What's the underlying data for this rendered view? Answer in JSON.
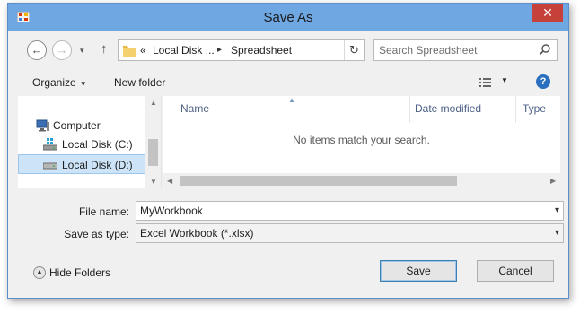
{
  "window": {
    "title": "Save As",
    "close_glyph": "✕"
  },
  "nav": {
    "back_glyph": "←",
    "forward_glyph": "→",
    "recent_glyph": "▾",
    "up_glyph": "↑"
  },
  "address": {
    "prefix": "«",
    "crumbs": [
      "Local Disk ...",
      "Spreadsheet"
    ],
    "separator": "▸",
    "refresh_glyph": "↻"
  },
  "search": {
    "placeholder": "Search Spreadsheet"
  },
  "toolbar": {
    "organize_label": "Organize",
    "new_folder_label": "New folder",
    "help_glyph": "?"
  },
  "tree": {
    "items": [
      {
        "label": "Computer",
        "icon": "computer-icon"
      },
      {
        "label": "Local Disk (C:)",
        "icon": "windows-drive-icon"
      },
      {
        "label": "Local Disk (D:)",
        "icon": "drive-icon",
        "selected": true
      }
    ]
  },
  "file_list": {
    "columns": [
      "Name",
      "Date modified",
      "Type"
    ],
    "empty_message": "No items match your search."
  },
  "form": {
    "file_name_label": "File name:",
    "file_name_value": "MyWorkbook",
    "save_type_label": "Save as type:",
    "save_type_value": "Excel Workbook (*.xlsx)"
  },
  "footer": {
    "hide_folders_label": "Hide Folders",
    "save_label": "Save",
    "cancel_label": "Cancel"
  },
  "colors": {
    "titlebar": "#6fa7e3",
    "close": "#c7413b",
    "selection": "#cde4f8"
  }
}
